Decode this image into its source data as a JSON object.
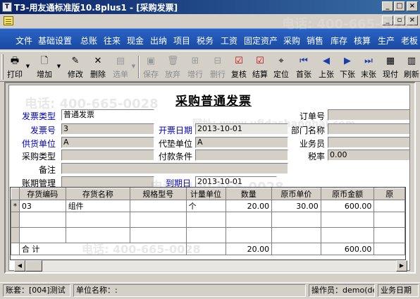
{
  "window": {
    "title": "T3-用友通标准版10.8plus1 - [采购发票]",
    "min_glyph": "_",
    "max_glyph": "□",
    "close_glyph": "×",
    "restore_glyph": "▫"
  },
  "watermark": {
    "line1": "电话: 400-665-0028",
    "line2": "网址: www.ufidashanghai.com",
    "line3": "电话: 400-665-0028"
  },
  "menu": [
    "文件",
    "基础设置",
    "总账",
    "往来",
    "现金",
    "出纳",
    "项目",
    "税务",
    "工资",
    "固定资产",
    "采购",
    "销售",
    "库存",
    "核算",
    "生产",
    "老板"
  ],
  "toolbar": {
    "print": "打印",
    "add": "增加",
    "edit": "修改",
    "delete": "删除",
    "select": "选单",
    "save": "保存",
    "discard": "放弃",
    "add_row": "增行",
    "delete_row": "删行",
    "review": "复核",
    "settle": "结算",
    "locate": "定位",
    "first": "首张",
    "prev": "上张",
    "next": "下张",
    "last": "末张",
    "cash": "现付",
    "refresh": "刷新"
  },
  "form": {
    "title": "采购普通发票",
    "labels": {
      "invoice_type": "发票类型",
      "invoice_no": "发票号",
      "vendor": "供货单位",
      "purchase_type": "采购类型",
      "note": "备注",
      "account_mgmt": "账期管理",
      "issue_date": "开票日期",
      "agent_vendor": "代垫单位",
      "payment_terms": "付款条件",
      "due_date": "到期日",
      "order_no": "订单号",
      "department": "部门名称",
      "salesperson": "业务员",
      "tax_rate": "税率"
    },
    "values": {
      "invoice_type": "普通发票",
      "invoice_no": "3",
      "vendor": "A",
      "purchase_type": "",
      "note": "",
      "account_mgmt": "",
      "issue_date": "2013-10-01",
      "agent_vendor": "A",
      "payment_terms": "",
      "due_date": "2013-10-01",
      "order_no": "",
      "department": "",
      "salesperson": "",
      "tax_rate": "0.00"
    }
  },
  "grid": {
    "columns": [
      "存货编码",
      "存货名称",
      "规格型号",
      "计量单位",
      "数量",
      "原币单价",
      "原币金额",
      "原"
    ],
    "rows": [
      {
        "marker": "*",
        "code": "03",
        "name": "组件",
        "spec": "",
        "unit": "个",
        "qty": "20.00",
        "price": "30.00",
        "amount": "600.00",
        "extra": ""
      }
    ],
    "total": {
      "label": "合 计",
      "qty": "20.00",
      "amount": "600.00"
    }
  },
  "statusbar": {
    "book": "账套：[004]测试",
    "unit": "单位名称：:",
    "operator": "操作员：demo(de",
    "biz_date": "业务日期"
  }
}
